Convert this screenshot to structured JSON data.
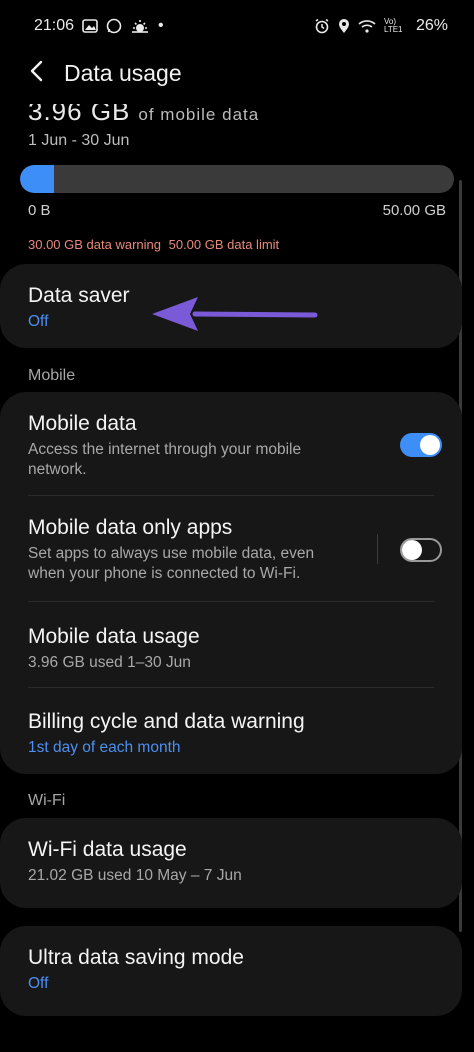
{
  "status": {
    "time": "21:06",
    "dot": "•",
    "network": "Vo) LTE1",
    "battery": "26%"
  },
  "header": {
    "title": "Data usage"
  },
  "summary": {
    "amount": "3.96 GB",
    "of_text": "of mobile data",
    "date_range": "1 Jun - 30 Jun",
    "used_fraction": 0.0792,
    "bar_min": "0 B",
    "bar_max": "50.00 GB",
    "warning": "30.00 GB data warning",
    "limit": "50.00 GB data limit"
  },
  "data_saver": {
    "title": "Data saver",
    "value": "Off"
  },
  "sections": {
    "mobile": "Mobile",
    "wifi": "Wi-Fi"
  },
  "mobile": {
    "mobile_data": {
      "title": "Mobile data",
      "desc": "Access the internet through your mobile network.",
      "enabled": true
    },
    "mobile_only_apps": {
      "title": "Mobile data only apps",
      "desc": "Set apps to always use mobile data, even when your phone is connected to Wi-Fi.",
      "enabled": false
    },
    "usage": {
      "title": "Mobile data usage",
      "desc": "3.96 GB used 1–30 Jun"
    },
    "billing": {
      "title": "Billing cycle and data warning",
      "desc": "1st day of each month"
    }
  },
  "wifi": {
    "usage": {
      "title": "Wi-Fi data usage",
      "desc": "21.02 GB used 10 May – 7 Jun"
    }
  },
  "ultra": {
    "title": "Ultra data saving mode",
    "value": "Off"
  },
  "colors": {
    "accent": "#3e8ef7",
    "arrow": "#7a5ad6",
    "warning": "#e88a7a"
  }
}
